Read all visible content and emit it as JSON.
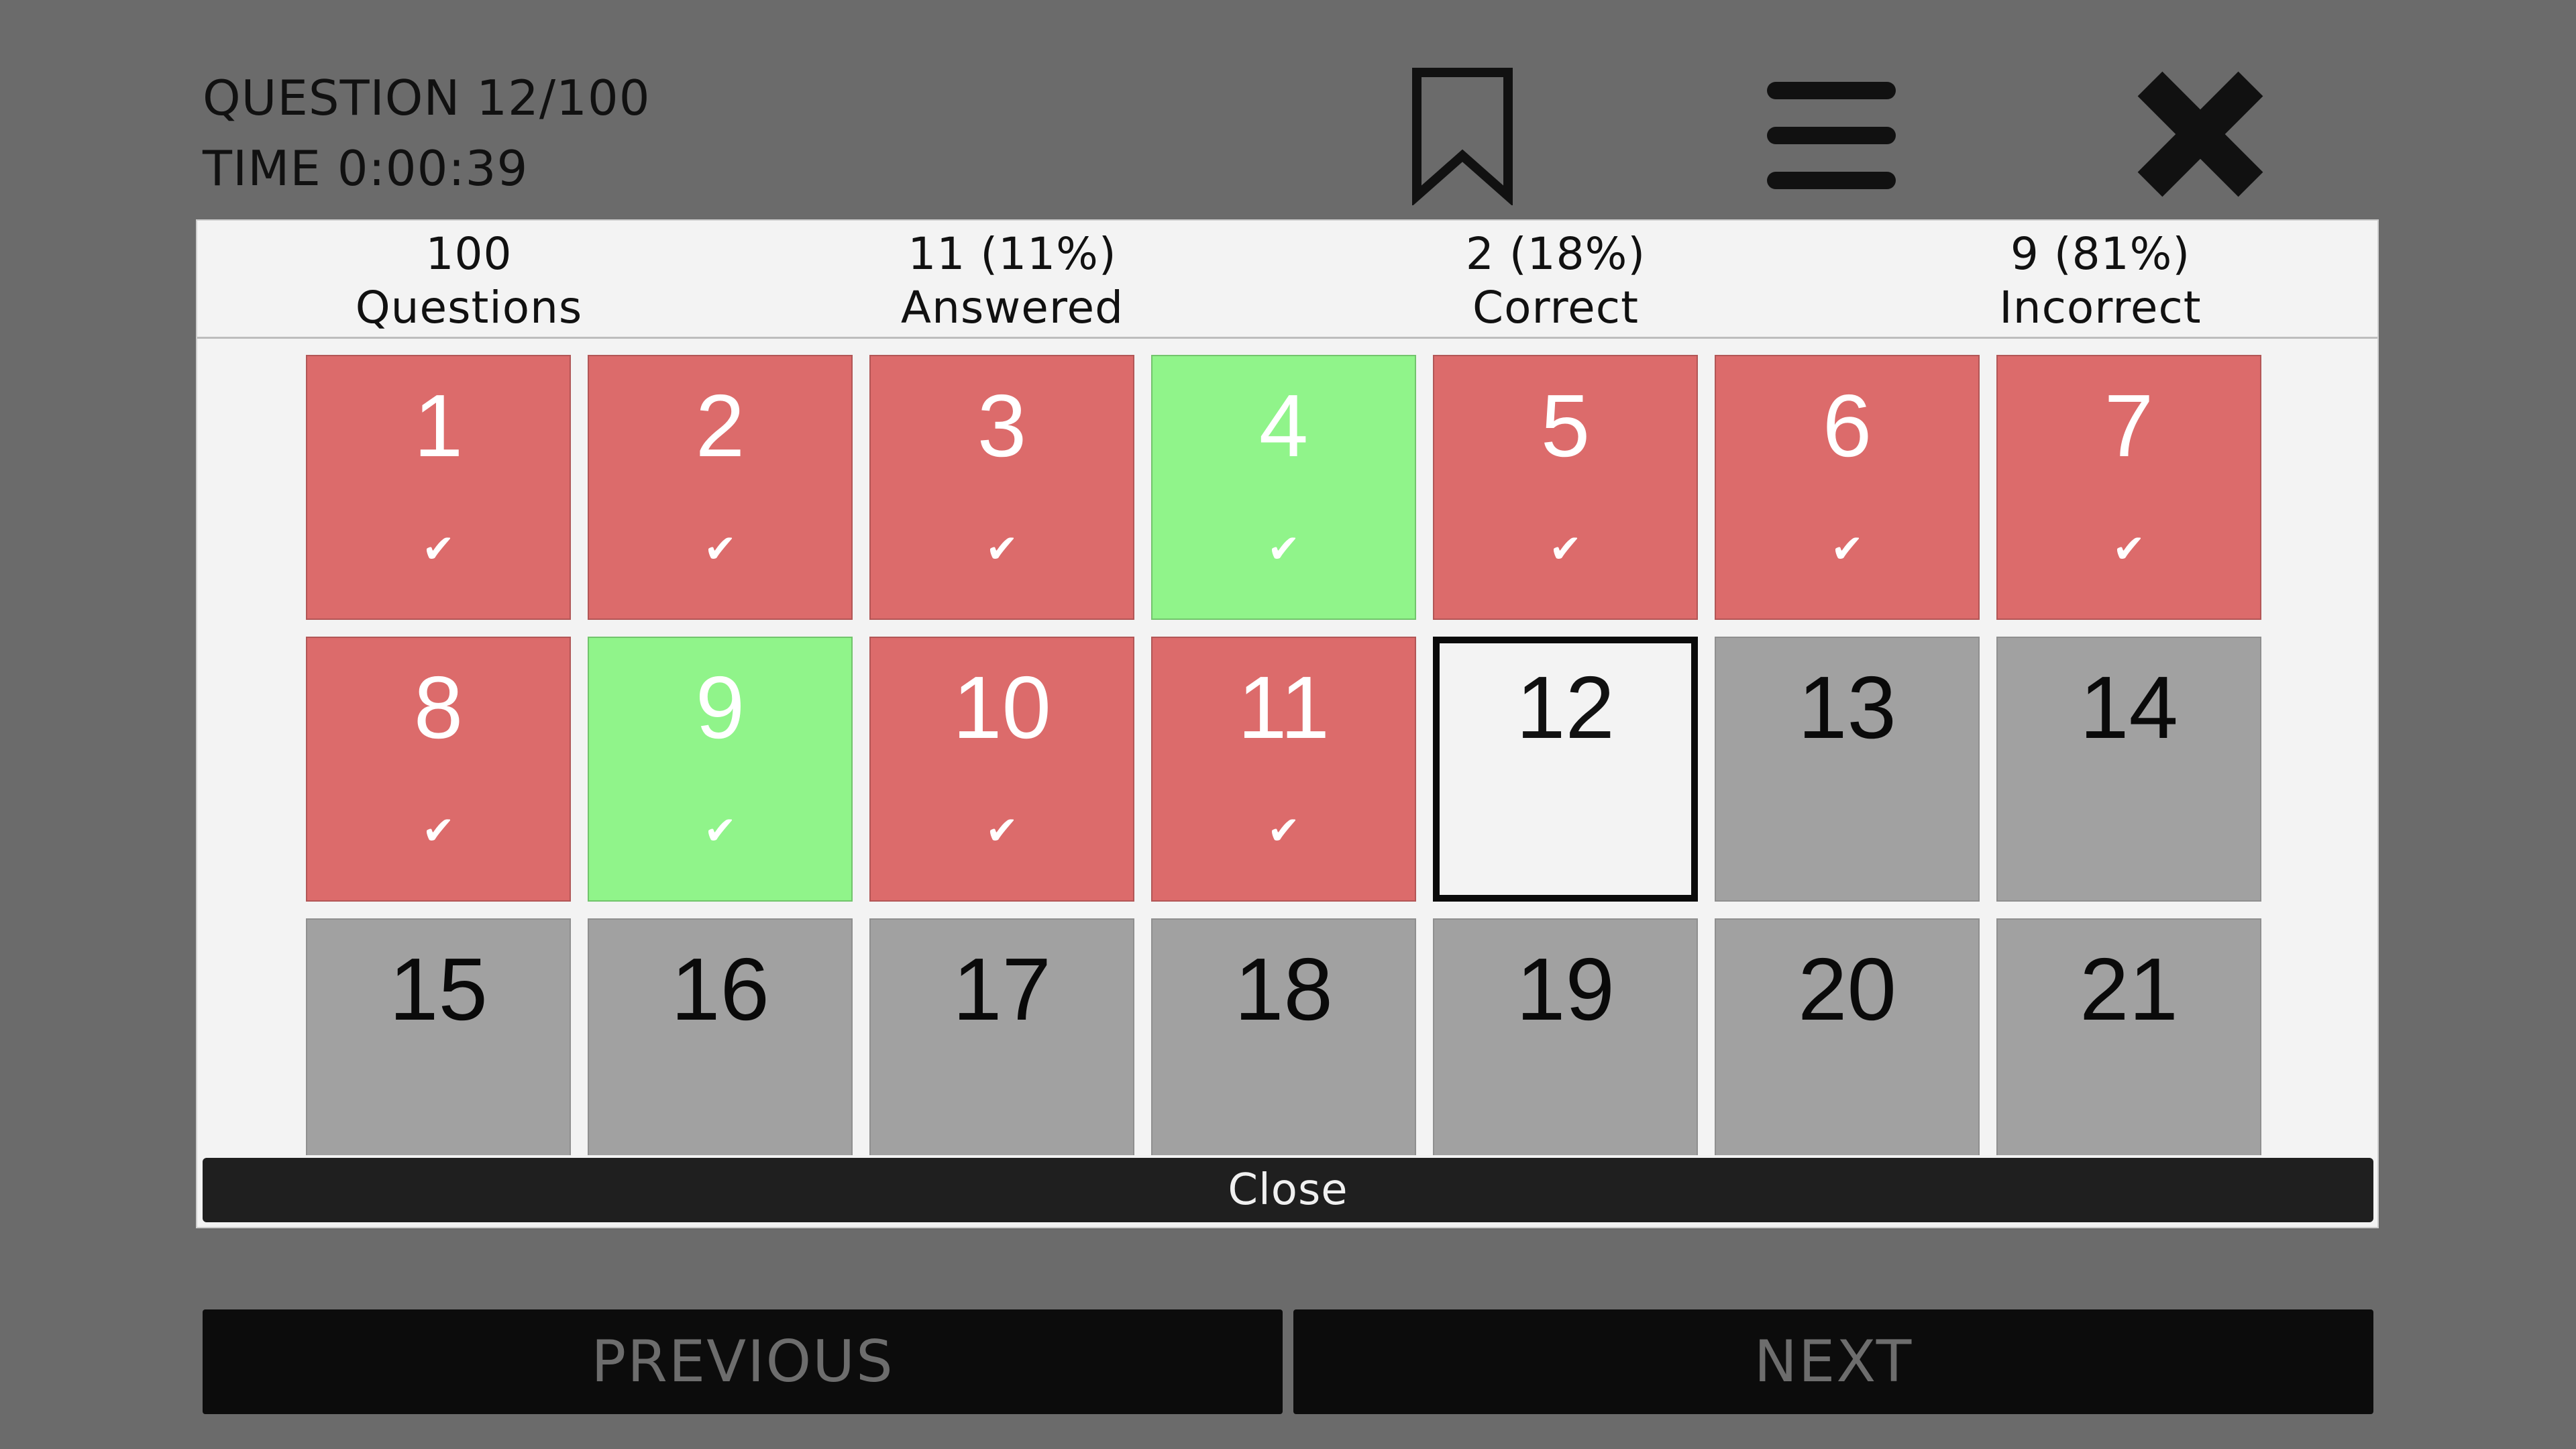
{
  "header": {
    "question_counter": "QUESTION 12/100",
    "timer": "TIME 0:00:39",
    "icons": [
      "bookmark-icon",
      "hamburger-menu-icon",
      "close-icon"
    ]
  },
  "summary": {
    "stats": [
      {
        "value": "100",
        "label": "Questions"
      },
      {
        "value": "11 (11%)",
        "label": "Answered"
      },
      {
        "value": "2 (18%)",
        "label": "Correct"
      },
      {
        "value": "9 (81%)",
        "label": "Incorrect"
      }
    ]
  },
  "grid": {
    "check_glyph": "✔",
    "tiles": [
      {
        "number": "1",
        "status": "incorrect",
        "answered": true
      },
      {
        "number": "2",
        "status": "incorrect",
        "answered": true
      },
      {
        "number": "3",
        "status": "incorrect",
        "answered": true
      },
      {
        "number": "4",
        "status": "correct",
        "answered": true
      },
      {
        "number": "5",
        "status": "incorrect",
        "answered": true
      },
      {
        "number": "6",
        "status": "incorrect",
        "answered": true
      },
      {
        "number": "7",
        "status": "incorrect",
        "answered": true
      },
      {
        "number": "8",
        "status": "incorrect",
        "answered": true
      },
      {
        "number": "9",
        "status": "correct",
        "answered": true
      },
      {
        "number": "10",
        "status": "incorrect",
        "answered": true
      },
      {
        "number": "11",
        "status": "incorrect",
        "answered": true
      },
      {
        "number": "12",
        "status": "current",
        "answered": false
      },
      {
        "number": "13",
        "status": "unanswered",
        "answered": false
      },
      {
        "number": "14",
        "status": "unanswered",
        "answered": false
      },
      {
        "number": "15",
        "status": "unanswered",
        "answered": false
      },
      {
        "number": "16",
        "status": "unanswered",
        "answered": false
      },
      {
        "number": "17",
        "status": "unanswered",
        "answered": false
      },
      {
        "number": "18",
        "status": "unanswered",
        "answered": false
      },
      {
        "number": "19",
        "status": "unanswered",
        "answered": false
      },
      {
        "number": "20",
        "status": "unanswered",
        "answered": false
      },
      {
        "number": "21",
        "status": "unanswered",
        "answered": false
      }
    ]
  },
  "modal": {
    "close_label": "Close"
  },
  "nav": {
    "previous_label": "PREVIOUS",
    "next_label": "NEXT"
  },
  "colors": {
    "background": "#6b6b6b",
    "incorrect": "#dc6b6b",
    "correct": "#90f48a",
    "unanswered": "#a1a1a1",
    "current": "#f3f3f3",
    "button": "#0c0c0c"
  }
}
